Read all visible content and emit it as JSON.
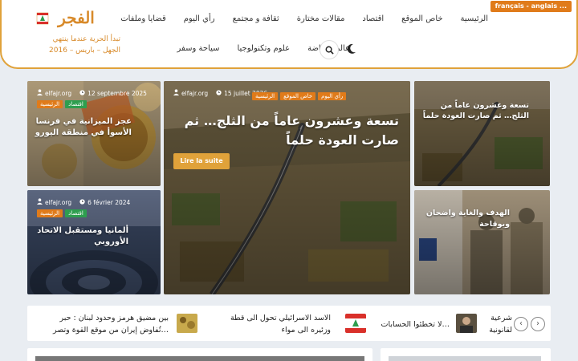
{
  "header": {
    "lang_badge": "français - anglais ...",
    "logo_text": "الفجر",
    "tagline_line1": "تبدأ الحرية عندما ينتهي",
    "tagline_line2": "الجهل – باريس – 2016",
    "nav_row1": [
      "قضايا وملفات",
      "رأي اليوم",
      "ثقافة و مجتمع",
      "مقالات مختارة",
      "اقتصاد",
      "خاص الموقع",
      "الرئيسية"
    ],
    "nav_row2": [
      "سياحة وسفر",
      "علوم وتكنولوجيا",
      "عالم الرياضة"
    ]
  },
  "cards": {
    "euro": {
      "author": "elfajr.org",
      "date": "12 septembre 2025",
      "tags": [
        "الرئيسية",
        "اقتصاد"
      ],
      "title_line1": "عجز الميزانية في فرنسا",
      "title_line2": "الأسوأ في منطقة اليورو"
    },
    "europe": {
      "author": "elfajr.org",
      "date": "6 février 2024",
      "tags": [
        "الرئيسية",
        "اقتصاد"
      ],
      "title_line1": "ألمانيا ومستقبل الاتحاد",
      "title_line2": "الأوروبي"
    },
    "hero": {
      "author": "elfajr.org",
      "date": "15 juillet 2026",
      "tags": [
        "الرئيسية",
        "خاص الموقع",
        "رأي اليوم"
      ],
      "title_line1": "تسعة وعشرون عاماً من الثلج… ثم",
      "title_line2": "صارت العودة حلماً",
      "button": "Lire la suite"
    },
    "right_top": {
      "title_line1": "تسعة وعشرون عاماً من",
      "title_line2": "الثلج… ثم صارت العودة حلماً"
    },
    "right_bottom": {
      "title_line1": "الهدف والغاية واضحان",
      "title_line2": "ويوقاحة"
    }
  },
  "ticker": {
    "items": [
      {
        "line1": "بين مضيق هرمز وحدود لبنان : حبر",
        "line2": "…تُفاوض إيران من موقع القوة وتصر"
      },
      {
        "line1": "الاسد الاسرائيلي تحول الى قطة",
        "line2": "وزئيره الى مواء"
      },
      {
        "line1": "…لا تخطئوا الحسابات",
        "line2": ""
      },
      {
        "line1": "شرعية",
        "line2": "لقانونية"
      }
    ],
    "prev_icon": "chevron-left-icon",
    "next_icon": "chevron-right-icon"
  },
  "colors": {
    "brand_orange": "#e07b1a",
    "brand_gold": "#e0a23a",
    "tag_green": "#2e9e4f"
  }
}
